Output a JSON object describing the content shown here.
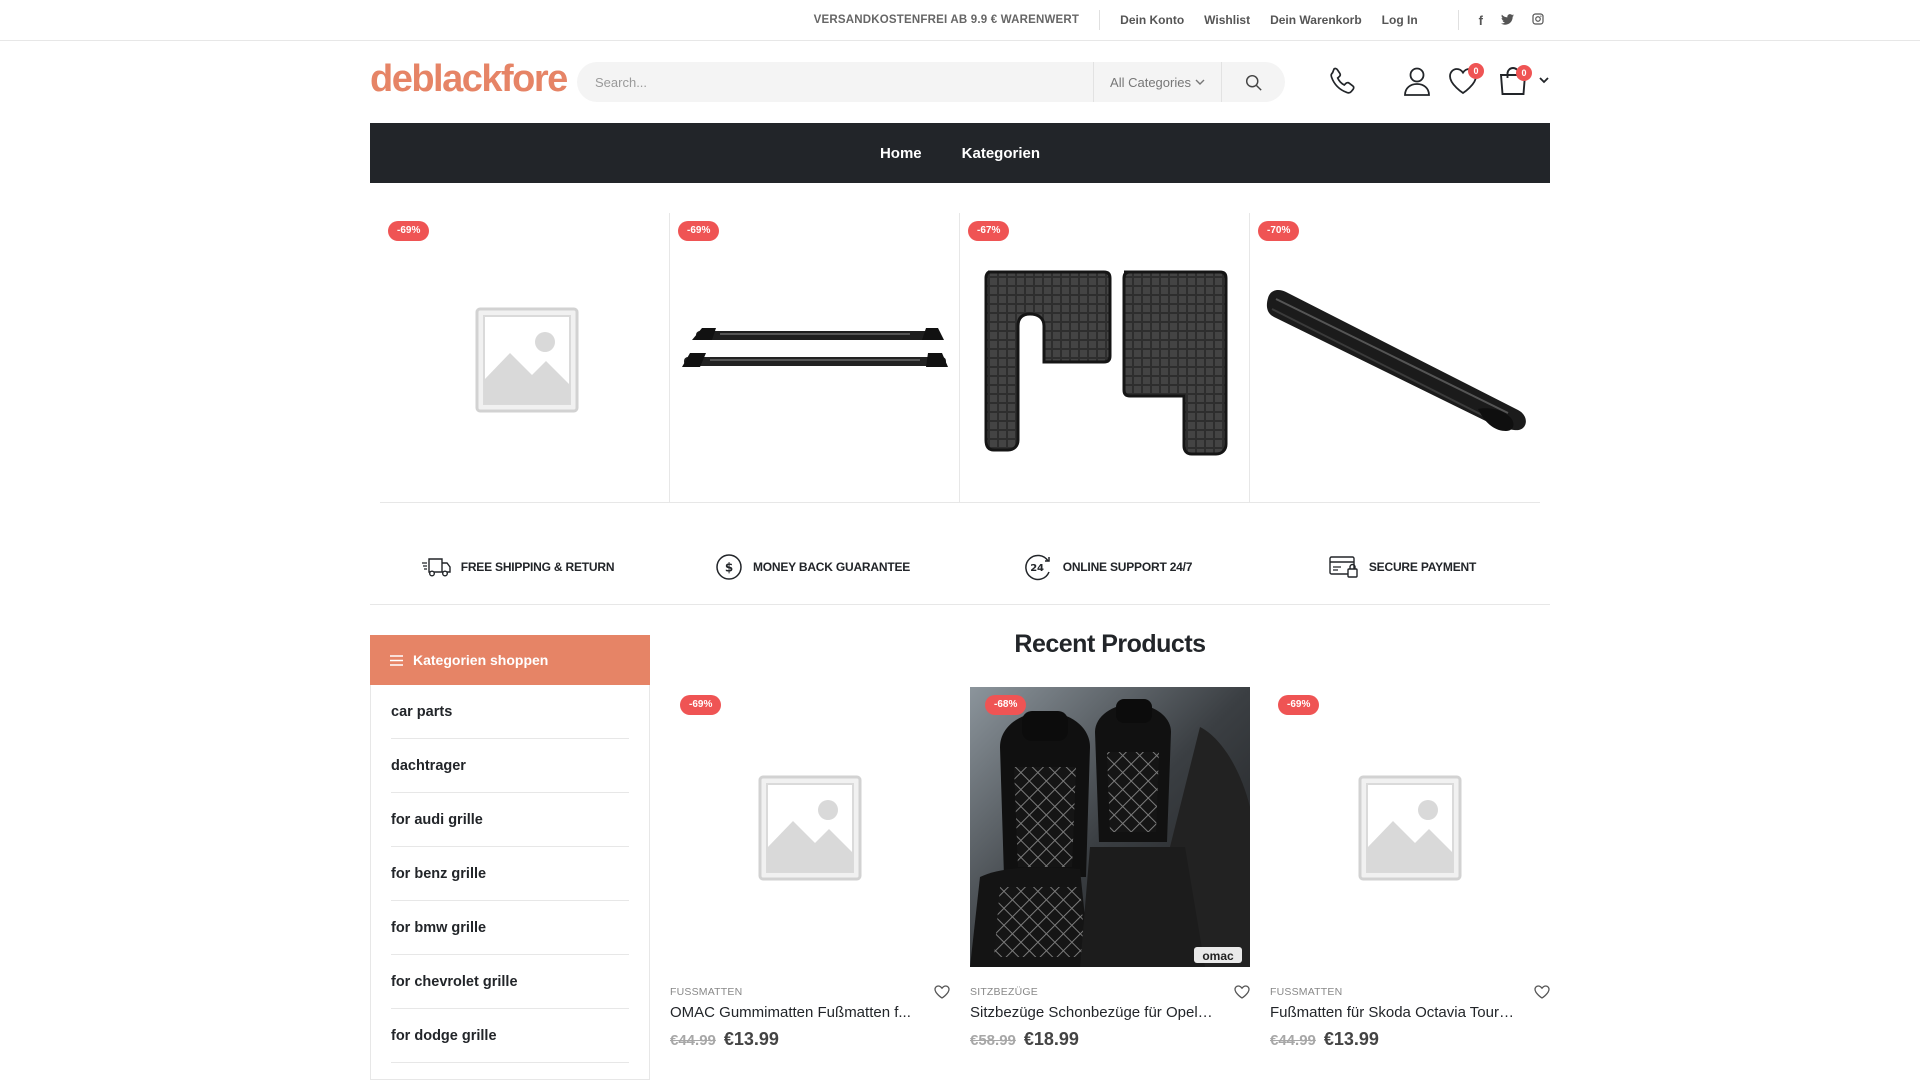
{
  "topbar": {
    "shipping": "VERSANDKOSTENFREI AB 9.9 € WARENWERT",
    "links": [
      "Dein Konto",
      "Wishlist",
      "Dein Warenkorb",
      "Log In"
    ],
    "social": [
      "facebook-icon",
      "twitter-icon",
      "instagram-icon"
    ]
  },
  "header": {
    "logo": "deblackfore",
    "search_placeholder": "Search...",
    "category_select": "All Categories",
    "wishlist_count": "0",
    "cart_count": "0"
  },
  "nav": {
    "items": [
      "Home",
      "Kategorien"
    ]
  },
  "top_products": [
    {
      "discount": "-69%",
      "image": "placeholder"
    },
    {
      "discount": "-69%",
      "image": "roof-bars"
    },
    {
      "discount": "-67%",
      "image": "floor-mats"
    },
    {
      "discount": "-70%",
      "image": "running-board"
    }
  ],
  "features": [
    {
      "icon": "truck-icon",
      "label": "FREE SHIPPING & RETURN"
    },
    {
      "icon": "dollar-circle-icon",
      "label": "MONEY BACK GUARANTEE"
    },
    {
      "icon": "support-24-icon",
      "label": "ONLINE SUPPORT 24/7"
    },
    {
      "icon": "secure-payment-icon",
      "label": "SECURE PAYMENT"
    }
  ],
  "sidebar": {
    "title": "Kategorien shoppen",
    "items": [
      "car parts",
      "dachtrager",
      "for audi grille",
      "for benz grille",
      "for bmw grille",
      "for chevrolet grille",
      "for dodge grille"
    ]
  },
  "recent": {
    "title": "Recent Products",
    "products": [
      {
        "discount": "-69%",
        "category": "FUSSMATTEN",
        "name": "OMAC Gummimatten Fußmatten f...",
        "old_price": "€44.99",
        "price": "€13.99",
        "image": "placeholder"
      },
      {
        "discount": "-68%",
        "category": "SITZBEZÜGE",
        "name": "Sitzbezüge Schonbezüge für Opel M...",
        "old_price": "€58.99",
        "price": "€18.99",
        "image": "seat-covers",
        "image_mark": "omac"
      },
      {
        "discount": "-69%",
        "category": "FUSSMATTEN",
        "name": "Fußmatten für Skoda Octavia Tour ...",
        "old_price": "€44.99",
        "price": "€13.99",
        "image": "placeholder"
      }
    ]
  },
  "colors": {
    "accent": "#e68466",
    "dark": "#222529",
    "badge": "#ef5454"
  }
}
